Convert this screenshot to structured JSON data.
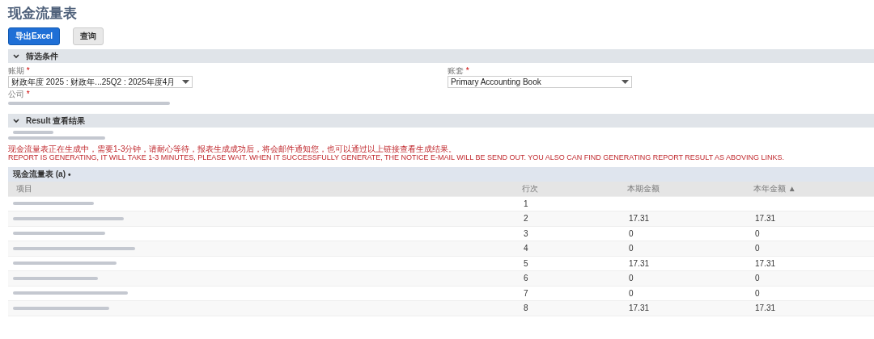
{
  "page": {
    "title": "现金流量表"
  },
  "toolbar": {
    "buttons": [
      {
        "label": "导出Excel",
        "kind": "primary"
      },
      {
        "label": "查询",
        "kind": "secondary"
      }
    ]
  },
  "filters": {
    "title": "筛选条件",
    "expanded": true,
    "fields": [
      {
        "label": "账期",
        "required_mark": "*",
        "value": "财政年度 2025 : 财政年...25Q2 : 2025年度4月",
        "kind": "select"
      },
      {
        "label": "账套",
        "required_mark": "*",
        "value": "Primary Accounting Book",
        "kind": "select"
      },
      {
        "label": "公司",
        "required_mark": "*",
        "kind": "redacted"
      }
    ]
  },
  "result": {
    "title": "Result 查看结果",
    "expanded": true,
    "messages": [
      "现金流量表正在生成中，需要1-3分钟，请耐心等待，报表生成成功后，将会邮件通知您，也可以通过以上链接查看生成结果。",
      "REPORT IS GENERATING, IT WILL TAKE 1-3 MINUTES, PLEASE WAIT. WHEN IT SUCCESSFULLY GENERATE, THE NOTICE E-MAIL WILL BE SEND OUT. YOU ALSO CAN FIND GENERATING REPORT RESULT AS ABOVING LINKS."
    ]
  },
  "table": {
    "title": "现金流量表 (a)",
    "title_mark": "•",
    "columns": [
      {
        "label": "项目"
      },
      {
        "label": "行次"
      },
      {
        "label": "本期金额"
      },
      {
        "label": "本年金额 ▲"
      }
    ],
    "rows": [
      {
        "line": "1"
      },
      {
        "line": "2",
        "current": "17.31",
        "ytd": "17.31"
      },
      {
        "line": "3",
        "current": "0",
        "ytd": "0"
      },
      {
        "line": "4",
        "current": "0",
        "ytd": "0"
      },
      {
        "line": "5",
        "current": "17.31",
        "ytd": "17.31"
      },
      {
        "line": "6",
        "current": "0",
        "ytd": "0"
      },
      {
        "line": "7",
        "current": "0",
        "ytd": "0"
      },
      {
        "line": "8",
        "current": "17.31",
        "ytd": "17.31"
      }
    ]
  }
}
